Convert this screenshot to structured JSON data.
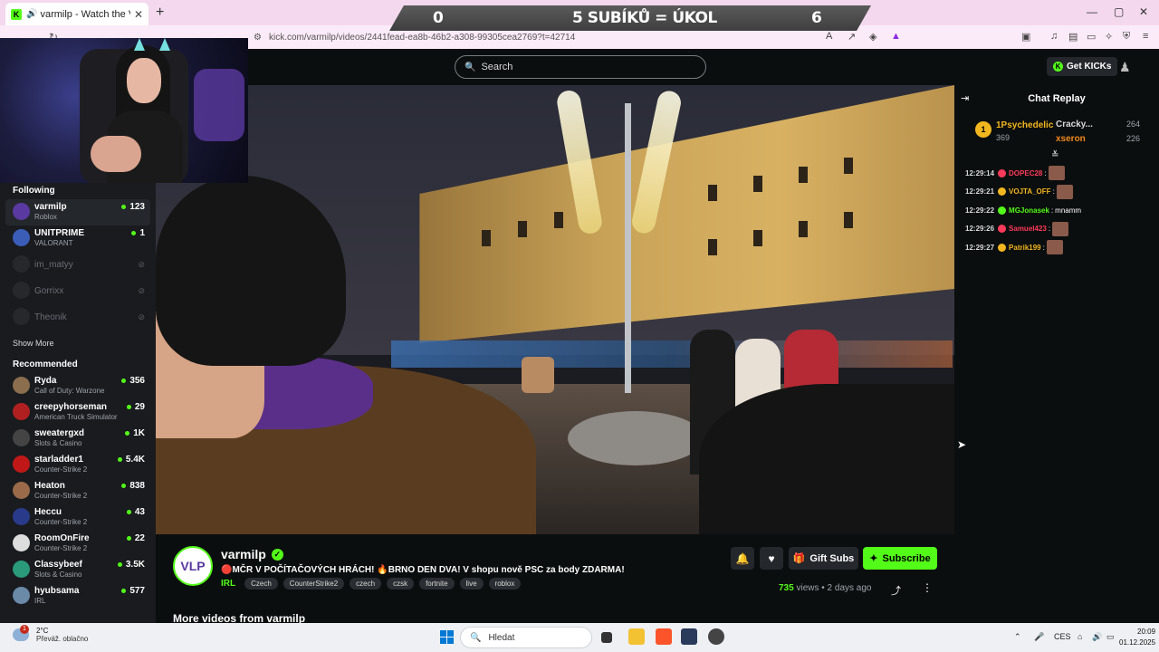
{
  "browser": {
    "tab_title": "varmilp - Watch the VOD on Kick",
    "tab_favicon_letter": "K",
    "url": "kick.com/varmilp/videos/2441fead-ea8b-46b2-a308-99305cea2769?t=42714"
  },
  "overlay": {
    "left": "0",
    "center": "5 SUBÍKŮ = ÚKOL",
    "right": "6"
  },
  "header": {
    "search_placeholder": "Search",
    "get_kicks": "Get KICKs"
  },
  "sidebar": {
    "following_heading": "Following",
    "following": [
      {
        "name": "varmilp",
        "category": "Roblox",
        "viewers": "123",
        "live": true,
        "avatar_color": "#5a3aa0"
      },
      {
        "name": "UNITPRIME",
        "category": "VALORANT",
        "viewers": "1",
        "live": true,
        "avatar_color": "#3b5db8"
      },
      {
        "name": "im_matyy",
        "category": "",
        "viewers": "",
        "live": false,
        "avatar_color": "#3a3c40"
      },
      {
        "name": "Gorrixx",
        "category": "",
        "viewers": "",
        "live": false,
        "avatar_color": "#3a3c40"
      },
      {
        "name": "Theonik",
        "category": "",
        "viewers": "",
        "live": false,
        "avatar_color": "#3a3c40"
      }
    ],
    "show_more": "Show More",
    "recommended_heading": "Recommended",
    "recommended": [
      {
        "name": "Ryda",
        "category": "Call of Duty: Warzone",
        "viewers": "356",
        "avatar_color": "#8a6e4e"
      },
      {
        "name": "creepyhorseman",
        "category": "American Truck Simulator",
        "viewers": "29",
        "avatar_color": "#b02020"
      },
      {
        "name": "sweatergxd",
        "category": "Slots & Casino",
        "viewers": "1K",
        "avatar_color": "#444"
      },
      {
        "name": "starladder1",
        "category": "Counter-Strike 2",
        "viewers": "5.4K",
        "avatar_color": "#c01818"
      },
      {
        "name": "Heaton",
        "category": "Counter-Strike 2",
        "viewers": "838",
        "avatar_color": "#9a6a4a"
      },
      {
        "name": "Heccu",
        "category": "Counter-Strike 2",
        "viewers": "43",
        "avatar_color": "#2a3a8a"
      },
      {
        "name": "RoomOnFire",
        "category": "Counter-Strike 2",
        "viewers": "22",
        "avatar_color": "#dddddd"
      },
      {
        "name": "Classybeef",
        "category": "Slots & Casino",
        "viewers": "3.5K",
        "avatar_color": "#2b9a7a"
      },
      {
        "name": "hyubsama",
        "category": "IRL",
        "viewers": "577",
        "avatar_color": "#6a8aa8"
      }
    ]
  },
  "stream": {
    "channel": "varmilp",
    "avatar_text": "VLP",
    "title": "🔴MČR V POČÍTAČOVÝCH HRÁCH! 🔥BRNO DEN DVA! V shopu nově PSC za body ZDARMA!",
    "category": "IRL",
    "tags": [
      "Czech",
      "CounterStrike2",
      "czech",
      "czsk",
      "fortnite",
      "live",
      "roblox"
    ],
    "gift_subs": "Gift Subs",
    "subscribe": "Subscribe",
    "views_count": "735",
    "views_label": "views",
    "age": "2 days ago",
    "more_videos": "More videos from varmilp"
  },
  "chat": {
    "title": "Chat Replay",
    "leaderboard": [
      {
        "rank": "1",
        "name": "1Psychedelic",
        "count": "369"
      },
      {
        "name": "Cracky...",
        "count": "264"
      },
      {
        "name": "xseron",
        "count": "226"
      }
    ],
    "messages": [
      {
        "time": "12:29:14",
        "user": "DOPEC28",
        "color": "#ff3a5a",
        "text": "",
        "emote": true
      },
      {
        "time": "12:29:21",
        "user": "VOJTA_OFF",
        "color": "#f2b61f",
        "text": "",
        "emote": true
      },
      {
        "time": "12:29:22",
        "user": "MGJonasek",
        "color": "#53fc18",
        "text": "mnamm",
        "emote": false
      },
      {
        "time": "12:29:26",
        "user": "Samuel423",
        "color": "#ff3a5a",
        "text": "",
        "emote": true
      },
      {
        "time": "12:29:27",
        "user": "Patrik199",
        "color": "#f2b61f",
        "text": "",
        "emote": true
      }
    ]
  },
  "taskbar": {
    "temp": "2°C",
    "weather": "Převáž. oblačno",
    "notif_count": "1",
    "search": "Hledat",
    "lang": "CES",
    "time": "20:09",
    "date": "01.12.2025"
  }
}
